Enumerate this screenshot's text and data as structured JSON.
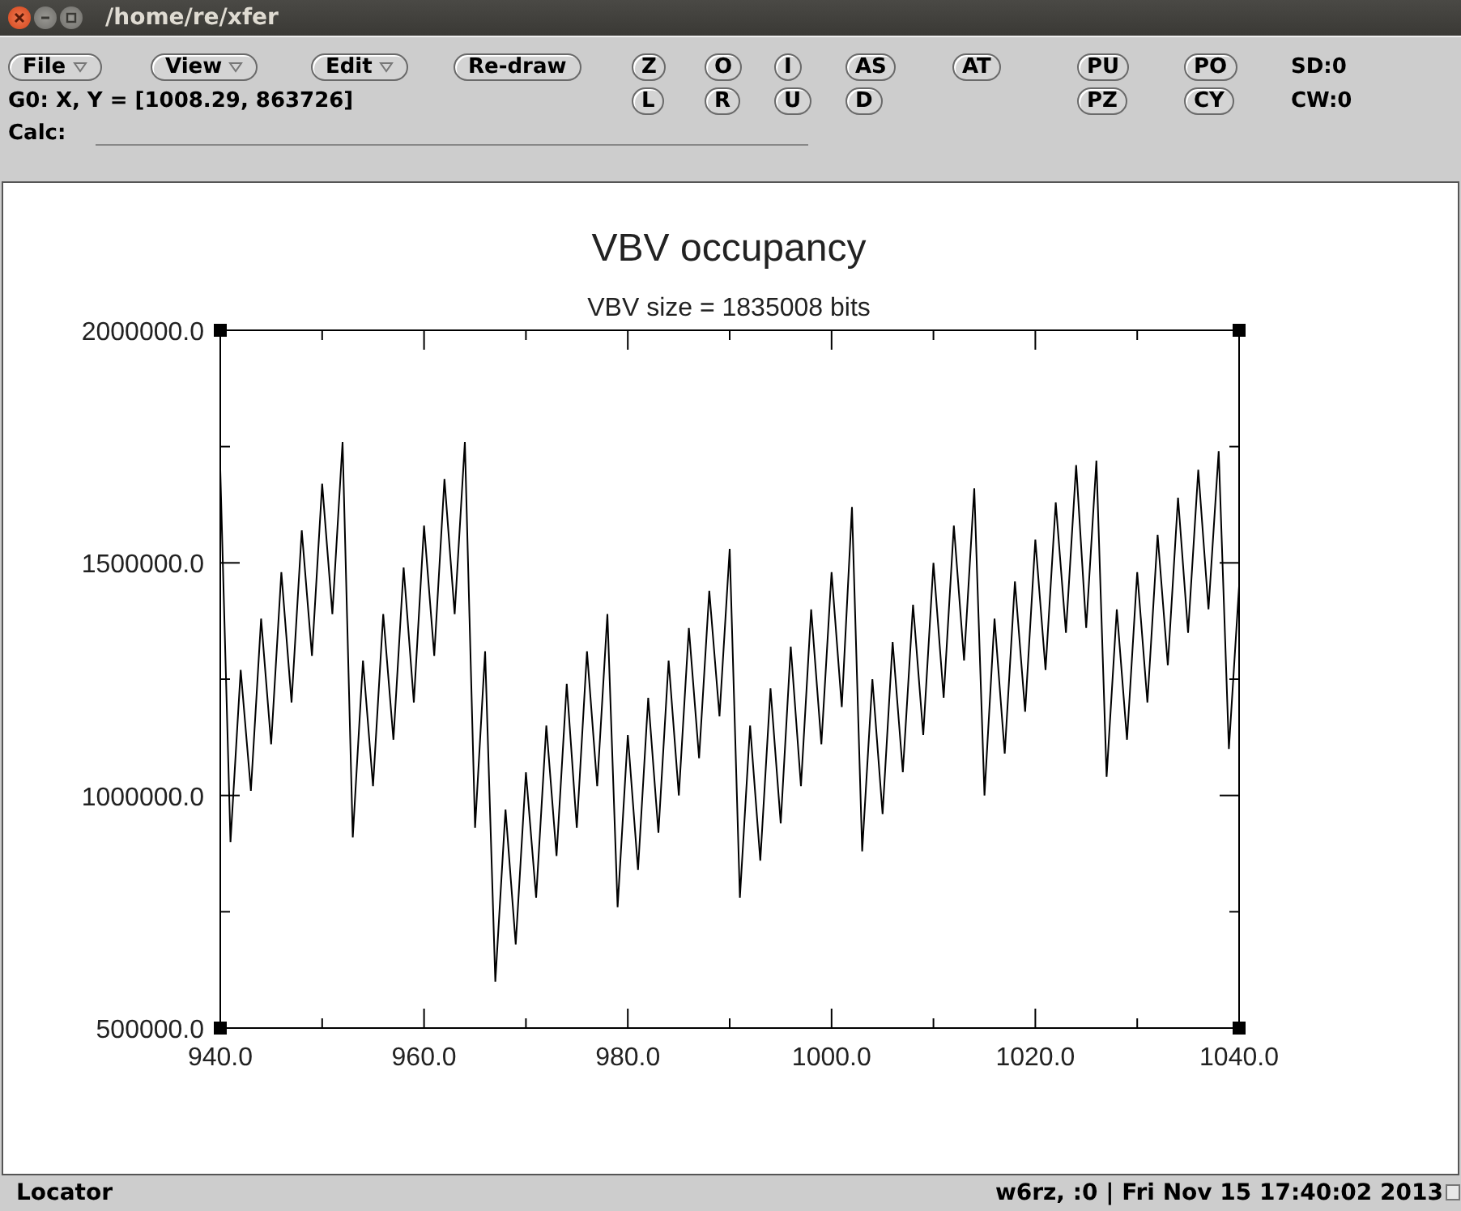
{
  "window": {
    "title": "/home/re/xfer"
  },
  "toolbar": {
    "row_1": [
      {
        "label": "File",
        "kind": "menu"
      },
      {
        "label": "View",
        "kind": "menu"
      },
      {
        "label": "Edit",
        "kind": "menu"
      },
      {
        "label": "Re-draw",
        "kind": "button"
      },
      {
        "label": "Z",
        "kind": "button"
      },
      {
        "label": "O",
        "kind": "button"
      },
      {
        "label": "I",
        "kind": "button"
      },
      {
        "label": "AS",
        "kind": "button"
      },
      {
        "label": "AT",
        "kind": "button"
      },
      {
        "label": "PU",
        "kind": "button"
      },
      {
        "label": "PO",
        "kind": "button"
      }
    ],
    "row_1_readout": "SD:0",
    "row_2": [
      {
        "label": "L"
      },
      {
        "label": "R"
      },
      {
        "label": "U"
      },
      {
        "label": "D"
      },
      {
        "label": "PZ"
      },
      {
        "label": "CY"
      }
    ],
    "row_2_readout": "CW:0",
    "cursor_readout": "G0: X, Y = [1008.29, 863726]",
    "calc": {
      "label": "Calc:"
    }
  },
  "plot": {
    "subtitle": "VBV size = 1835008 bits",
    "chart_data": {
      "type": "line",
      "title": "VBV occupancy",
      "xlim": [
        940,
        1040
      ],
      "ylim": [
        500000,
        2000000
      ],
      "xticks": [
        {
          "value": 940,
          "label": "940.0"
        },
        {
          "value": 960,
          "label": "960.0"
        },
        {
          "value": 980,
          "label": "980.0"
        },
        {
          "value": 1000,
          "label": "1000.0"
        },
        {
          "value": 1020,
          "label": "1020.0"
        },
        {
          "value": 1040,
          "label": "1040.0"
        }
      ],
      "yticks": [
        {
          "value": 500000,
          "label": "500000.0"
        },
        {
          "value": 1000000,
          "label": "1000000.0"
        },
        {
          "value": 1500000,
          "label": "1500000.0"
        },
        {
          "value": 2000000,
          "label": "2000000.0"
        }
      ],
      "x": [
        940,
        941,
        942,
        943,
        944,
        945,
        946,
        947,
        948,
        949,
        950,
        951,
        952,
        953,
        954,
        955,
        956,
        957,
        958,
        959,
        960,
        961,
        962,
        963,
        964,
        965,
        966,
        967,
        968,
        969,
        970,
        971,
        972,
        973,
        974,
        975,
        976,
        977,
        978,
        979,
        980,
        981,
        982,
        983,
        984,
        985,
        986,
        987,
        988,
        989,
        990,
        991,
        992,
        993,
        994,
        995,
        996,
        997,
        998,
        999,
        1000,
        1001,
        1002,
        1003,
        1004,
        1005,
        1006,
        1007,
        1008,
        1009,
        1010,
        1011,
        1012,
        1013,
        1014,
        1015,
        1016,
        1017,
        1018,
        1019,
        1020,
        1021,
        1022,
        1023,
        1024,
        1025,
        1026,
        1027,
        1028,
        1029,
        1030,
        1031,
        1032,
        1033,
        1034,
        1035,
        1036,
        1037,
        1038,
        1039,
        1040
      ],
      "values": [
        1700000,
        900000,
        1270000,
        1010000,
        1380000,
        1110000,
        1480000,
        1200000,
        1570000,
        1300000,
        1670000,
        1390000,
        1760000,
        910000,
        1290000,
        1020000,
        1390000,
        1120000,
        1490000,
        1200000,
        1580000,
        1300000,
        1680000,
        1390000,
        1760000,
        930000,
        1310000,
        600000,
        970000,
        680000,
        1050000,
        780000,
        1150000,
        870000,
        1240000,
        930000,
        1310000,
        1020000,
        1390000,
        760000,
        1130000,
        840000,
        1210000,
        920000,
        1290000,
        1000000,
        1360000,
        1080000,
        1440000,
        1170000,
        1530000,
        780000,
        1150000,
        860000,
        1230000,
        940000,
        1320000,
        1020000,
        1400000,
        1110000,
        1480000,
        1190000,
        1620000,
        880000,
        1250000,
        960000,
        1330000,
        1050000,
        1410000,
        1130000,
        1500000,
        1210000,
        1580000,
        1290000,
        1660000,
        1000000,
        1380000,
        1090000,
        1460000,
        1180000,
        1550000,
        1270000,
        1630000,
        1350000,
        1710000,
        1360000,
        1720000,
        1040000,
        1400000,
        1120000,
        1480000,
        1200000,
        1560000,
        1280000,
        1640000,
        1350000,
        1700000,
        1400000,
        1740000,
        1100000,
        1450000
      ]
    }
  },
  "status_bar": {
    "left": "Locator",
    "right": "w6rz, :0 | Fri Nov 15 17:40:02 2013"
  }
}
